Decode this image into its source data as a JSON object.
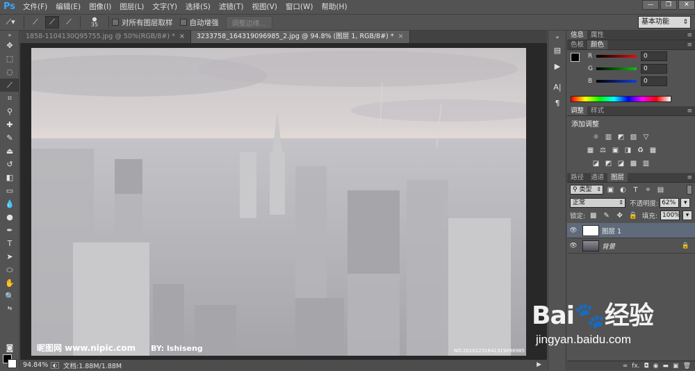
{
  "app": {
    "logo": "Ps"
  },
  "menu": [
    "文件(F)",
    "编辑(E)",
    "图像(I)",
    "图层(L)",
    "文字(Y)",
    "选择(S)",
    "滤镜(T)",
    "视图(V)",
    "窗口(W)",
    "帮助(H)"
  ],
  "window_controls": {
    "minimize": "—",
    "restore": "❐",
    "close": "✕"
  },
  "options_bar": {
    "brush_size": "35",
    "sample_all_layers": "对所有图层取样",
    "auto_enhance": "自动增强",
    "refine_edge": "调整边缘...",
    "workspace": "基本功能"
  },
  "tabs": [
    {
      "label": "1858-1104130Q95755.jpg @ 50%(RGB/8#) *",
      "close": "×"
    },
    {
      "label": "3233758_164319096985_2.jpg @ 94.8% (图层 1, RGB/8#) *",
      "close": "×"
    }
  ],
  "image": {
    "credit_left": "昵图网 www.nipic.com",
    "credit_by": "BY: lshiseng",
    "credit_no": "NO:20101231641319096985"
  },
  "status": {
    "zoom": "94.84%",
    "doc": "文档:1.88M/1.88M",
    "arrow": "▶"
  },
  "panels": {
    "info_tabs": [
      "信息",
      "属性"
    ],
    "color_tabs": [
      "色板",
      "颜色"
    ],
    "rgb": [
      {
        "label": "R",
        "value": "0",
        "color": "#e01010"
      },
      {
        "label": "G",
        "value": "0",
        "color": "#10c010"
      },
      {
        "label": "B",
        "value": "0",
        "color": "#1040e0"
      }
    ],
    "adjust_tabs": [
      "调整",
      "样式"
    ],
    "adjust_title": "添加调整",
    "adjust_icons_row1": [
      "☼",
      "▥",
      "◩",
      "▨",
      "▽"
    ],
    "adjust_icons_row2": [
      "▦",
      "⚖",
      "▣",
      "◨",
      "♻",
      "▦"
    ],
    "adjust_icons_row3": [
      "◪",
      "◩",
      "◪",
      "▩",
      "▥"
    ],
    "layer_tabs": [
      "路径",
      "通道",
      "图层"
    ],
    "filter_kind": "类型",
    "blend_mode": "正常",
    "opacity_label": "不透明度:",
    "opacity_value": "62%",
    "lock_label": "锁定:",
    "fill_label": "填充:",
    "fill_value": "100%",
    "layers": [
      {
        "name": "图层 1",
        "selected": true
      },
      {
        "name": "背景",
        "selected": false,
        "locked": true
      }
    ],
    "footer_icons": [
      "∞",
      "fx.",
      "◘",
      "◉",
      "▬",
      "▣",
      "🗑"
    ]
  },
  "watermark": {
    "logo": "Bai🐾经验",
    "url": "jingyan.baidu.com"
  }
}
